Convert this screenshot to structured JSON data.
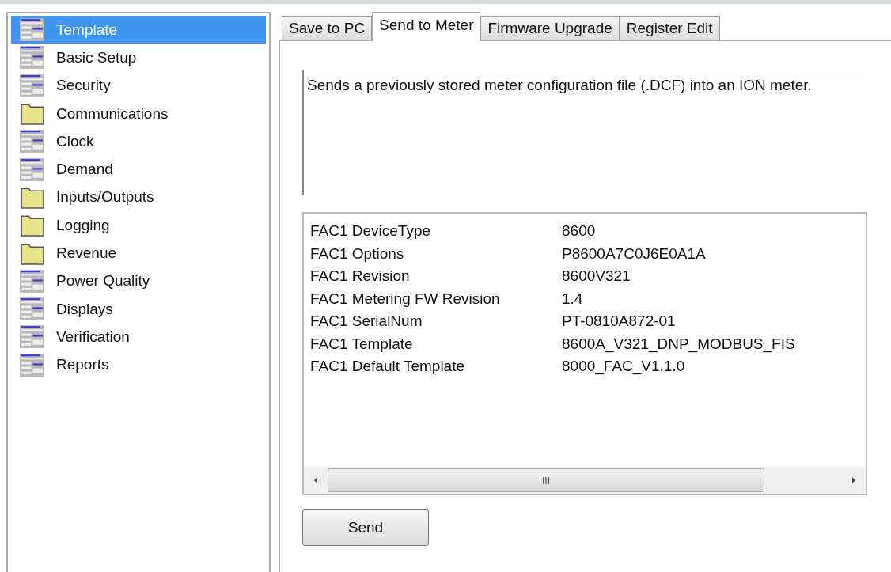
{
  "tree": {
    "items": [
      {
        "label": "Template",
        "kind": "form",
        "selected": true
      },
      {
        "label": "Basic Setup",
        "kind": "form",
        "selected": false
      },
      {
        "label": "Security",
        "kind": "form",
        "selected": false
      },
      {
        "label": "Communications",
        "kind": "folder",
        "selected": false
      },
      {
        "label": "Clock",
        "kind": "form",
        "selected": false
      },
      {
        "label": "Demand",
        "kind": "form",
        "selected": false
      },
      {
        "label": "Inputs/Outputs",
        "kind": "folder",
        "selected": false
      },
      {
        "label": "Logging",
        "kind": "folder",
        "selected": false
      },
      {
        "label": "Revenue",
        "kind": "folder",
        "selected": false
      },
      {
        "label": "Power Quality",
        "kind": "form",
        "selected": false
      },
      {
        "label": "Displays",
        "kind": "form",
        "selected": false
      },
      {
        "label": "Verification",
        "kind": "form",
        "selected": false
      },
      {
        "label": "Reports",
        "kind": "form",
        "selected": false
      }
    ]
  },
  "tabs": [
    {
      "label": "Save to PC",
      "selected": false
    },
    {
      "label": "Send to Meter",
      "selected": true
    },
    {
      "label": "Firmware Upgrade",
      "selected": false
    },
    {
      "label": "Register Edit",
      "selected": false
    }
  ],
  "description": "Sends a previously stored meter configuration file (.DCF) into an ION meter.",
  "info_list": {
    "rows": [
      {
        "name": "FAC1 DeviceType",
        "value": "8600"
      },
      {
        "name": "FAC1 Options",
        "value": "P8600A7C0J6E0A1A"
      },
      {
        "name": "FAC1 Revision",
        "value": "8600V321"
      },
      {
        "name": "FAC1 Metering FW Revision",
        "value": "1.4"
      },
      {
        "name": "FAC1 SerialNum",
        "value": "PT-0810A872-01"
      },
      {
        "name": "FAC1 Template",
        "value": "8600A_V321_DNP_MODBUS_FIS"
      },
      {
        "name": "FAC1 Default Template",
        "value": "8000_FAC_V1.1.0"
      }
    ],
    "scroll_grip": "III"
  },
  "send_button": "Send"
}
